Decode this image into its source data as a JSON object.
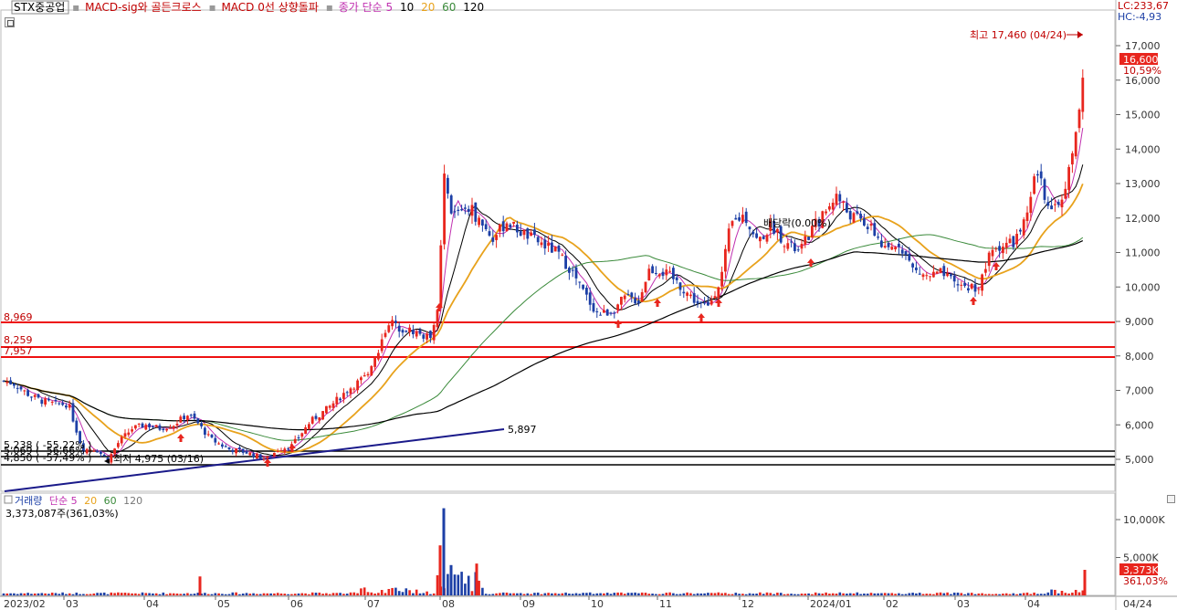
{
  "colors": {
    "up": "#e8261e",
    "down": "#1c3fa6",
    "ma5": "#c030b0",
    "ma10": "#000000",
    "ma20": "#e8a21c",
    "ma60": "#3a8a3a",
    "ma120": "#000000",
    "support_lines": "#ee1010",
    "trend_line": "#1a1a8a",
    "low_lines": "#000000"
  },
  "legend": {
    "stock": "STX중공업",
    "ind1": "MACD-sig와 골든크로스",
    "ind2": "MACD 0선 상향돌파",
    "ma_prefix": "종가 단순 5",
    "ma10": "10",
    "ma20": "20",
    "ma60": "60",
    "ma120": "120"
  },
  "corner": {
    "lc": "LC:233,67",
    "hc": "HC:-4,93"
  },
  "price_panel": {
    "high_label": "최고 17,460 (04/24)",
    "low_label": "최저 4,975 (03/16)",
    "dividend_label": "배당락(0.00%)",
    "last_price": "16,600",
    "last_change": "10,59%",
    "support_lines": [
      "8,969",
      "8,259",
      "7,957"
    ],
    "low_lines": [
      "5,238 ( -55,22% )",
      "5,069 ( -56,66% )",
      "4,850 ( -57,49% )"
    ],
    "trend_end_label": "5,897"
  },
  "volume_panel": {
    "legend_title": "거래량",
    "legend_ma": "단순 5",
    "legend_20": "20",
    "legend_60": "60",
    "legend_120": "120",
    "last_volume": "3,373,087주(361,03%)",
    "tag_value": "3,373K",
    "tag_pct": "361,03%"
  },
  "chart_data": {
    "type": "candlestick",
    "x": [
      "2023/02",
      "03",
      "04",
      "05",
      "06",
      "07",
      "08",
      "09",
      "10",
      "11",
      "12",
      "2024/01",
      "02",
      "03",
      "04",
      "04/24"
    ],
    "price_axis": {
      "ylim": [
        4500,
        18000
      ],
      "ticks": [
        "5,000",
        "6,000",
        "7,000",
        "8,000",
        "9,000",
        "10,000",
        "11,000",
        "12,000",
        "13,000",
        "14,000",
        "15,000",
        "16,000",
        "17,000"
      ]
    },
    "volume_axis": {
      "ylim": [
        0,
        12000
      ],
      "ticks": [
        "5,000K",
        "10,000K"
      ]
    },
    "monthly_close_path": [
      {
        "x": "2023/02",
        "close": 7200
      },
      {
        "x": "03",
        "close": 5600
      },
      {
        "x": "03/16",
        "close": 4975
      },
      {
        "x": "04",
        "close": 5700
      },
      {
        "x": "05",
        "close": 5250
      },
      {
        "x": "06",
        "close": 5300
      },
      {
        "x": "07",
        "close": 8900
      },
      {
        "x": "08",
        "close": 12000
      },
      {
        "x": "09",
        "close": 11000
      },
      {
        "x": "10",
        "close": 9200
      },
      {
        "x": "11",
        "close": 10000
      },
      {
        "x": "12",
        "close": 12000
      },
      {
        "x": "2024/01",
        "close": 12000
      },
      {
        "x": "02",
        "close": 10400
      },
      {
        "x": "03",
        "close": 10200
      },
      {
        "x": "04",
        "close": 12600
      },
      {
        "x": "04/24",
        "close": 16600
      }
    ],
    "high": 17460,
    "low": 4975,
    "last_close": 16600
  }
}
